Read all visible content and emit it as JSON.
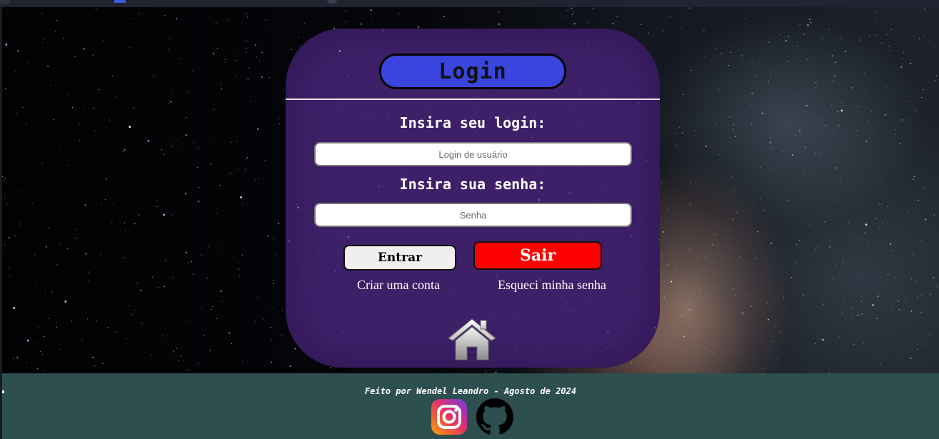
{
  "login": {
    "title": "Login",
    "username_label": "Insira seu login:",
    "username_placeholder": "Login de usuário",
    "password_label": "Insira sua senha:",
    "password_placeholder": "Senha",
    "enter_button": "Entrar",
    "exit_button": "Sair",
    "create_account_link": "Criar uma conta",
    "forgot_password_link": "Esqueci minha senha",
    "home_icon": "home-icon"
  },
  "footer": {
    "credit": "Feito por Wendel Leandro - Agosto de 2024",
    "icons": [
      "instagram-icon",
      "github-icon"
    ]
  },
  "colors": {
    "card": "#3e2068",
    "title_pill": "#3a45dd",
    "exit_button": "#ff0000",
    "footer": "#2e4f4f"
  }
}
